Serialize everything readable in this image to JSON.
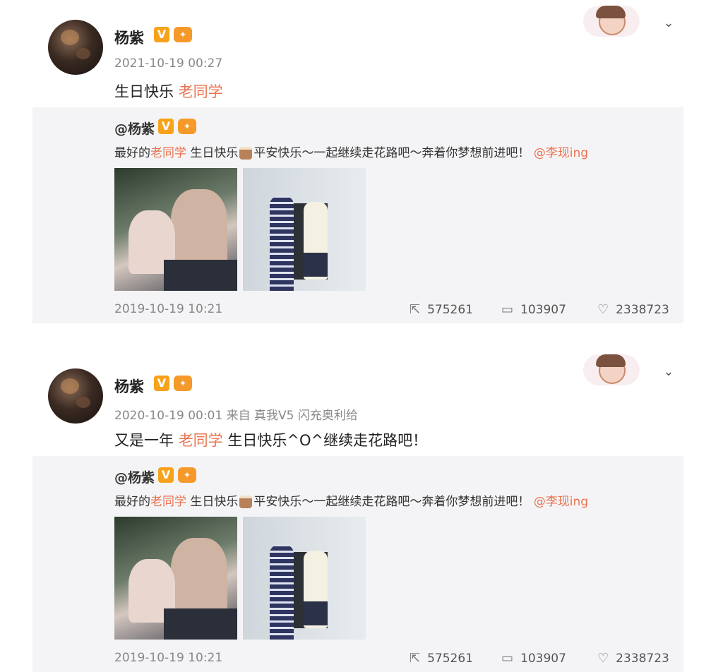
{
  "posts": [
    {
      "author": "杨紫",
      "v_badge": "V",
      "level_badge": "lv",
      "meta": "2021-10-19 00:27",
      "content_plain": "生日快乐 ",
      "content_highlight": "老同学",
      "content_tail": "",
      "repost": {
        "author": "@杨紫",
        "text_parts": [
          "最好的",
          "老同学",
          " 生日快乐",
          "平安快乐～一起继续走花路吧～奔着你梦想前进吧！"
        ],
        "mention": "@李现ing",
        "date": "2019-10-19 10:21",
        "reposts": "575261",
        "comments": "103907",
        "likes": "2338723"
      }
    },
    {
      "author": "杨紫",
      "v_badge": "V",
      "level_badge": "lv",
      "meta": "2020-10-19 00:01 来自 真我V5 闪充奥利给",
      "content_plain": "又是一年 ",
      "content_highlight": "老同学",
      "content_tail": " 生日快乐^O^继续走花路吧！",
      "repost": {
        "author": "@杨紫",
        "text_parts": [
          "最好的",
          "老同学",
          " 生日快乐",
          "平安快乐～一起继续走花路吧～奔着你梦想前进吧！"
        ],
        "mention": "@李现ing",
        "date": "2019-10-19 10:21",
        "reposts": "575261",
        "comments": "103907",
        "likes": "2338723"
      }
    }
  ],
  "icons": {
    "repost": "repost-icon",
    "comment": "comment-icon",
    "like": "like-icon",
    "more": "chevron-down-icon"
  },
  "colors": {
    "highlight": "#eb7350",
    "badge": "#f7a21b",
    "card_bg": "#f4f4f6"
  }
}
